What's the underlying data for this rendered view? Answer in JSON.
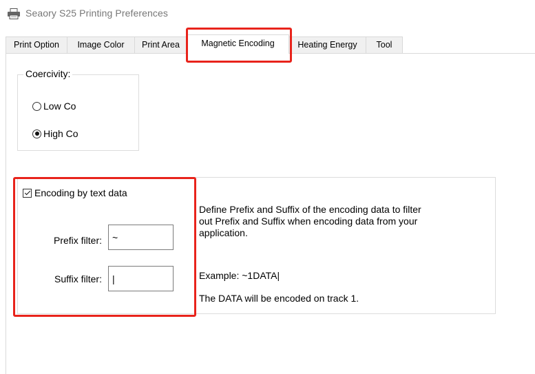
{
  "window": {
    "title": "Seaory S25 Printing Preferences",
    "icon": "printer-icon"
  },
  "tabs": [
    {
      "label": "Print Option",
      "active": false
    },
    {
      "label": "Image Color",
      "active": false
    },
    {
      "label": "Print Area",
      "active": false
    },
    {
      "label": "Magnetic Encoding",
      "active": true
    },
    {
      "label": "Heating Energy",
      "active": false
    },
    {
      "label": "Tool",
      "active": false
    }
  ],
  "coercivity": {
    "legend": "Coercivity:",
    "options": [
      {
        "label": "Low Co",
        "selected": false
      },
      {
        "label": "High Co",
        "selected": true
      }
    ]
  },
  "encoding": {
    "checkbox_label": "Encoding by text data",
    "checked": true,
    "prefix_label": "Prefix filter:",
    "prefix_value": "~",
    "suffix_label": "Suffix filter:",
    "suffix_value": "|"
  },
  "description": {
    "line1": "Define Prefix and Suffix of the encoding data to filter",
    "line2": "out Prefix and Suffix when encoding data from your",
    "line3": "application.",
    "example": "Example: ~1DATA|",
    "note": "The DATA will be encoded on track 1."
  },
  "colors": {
    "highlight": "#e8231b",
    "border": "#dcdcdc",
    "title_text": "#777777"
  }
}
